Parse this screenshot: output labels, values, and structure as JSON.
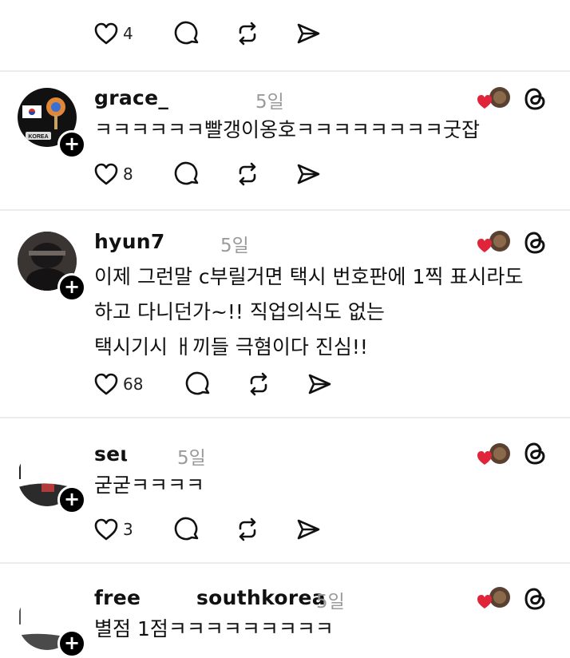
{
  "top_actions": {
    "likes": "4"
  },
  "comments": [
    {
      "username": "grace_",
      "time": "5일",
      "lines": [
        "ㅋㅋㅋㅋㅋㅋ빨갱이옹호ㅋㅋㅋㅋㅋㅋㅋㅋ굿잡"
      ],
      "likes": "8",
      "avatar_label": "KOREA"
    },
    {
      "username": "hyun7",
      "time": "5일",
      "lines": [
        "이제 그런말 c부릴거면 택시 번호판에 1찍 표시라도",
        "하고 다니던가~!! 직업의식도 없는",
        "택시기시 ㅐ끼들 극혐이다 진심!!"
      ],
      "likes": "68"
    },
    {
      "username": "seι",
      "time": "5일",
      "lines": [
        "굳굳ㅋㅋㅋㅋ"
      ],
      "likes": "3"
    },
    {
      "username_left": "free",
      "username_right": "southkorea",
      "time": "5일",
      "lines": [
        "별점 1점ㅋㅋㅋㅋㅋㅋㅋㅋㅋ"
      ]
    }
  ],
  "icons": [
    "heart-icon",
    "comment-icon",
    "repost-icon",
    "share-icon",
    "threads-icon",
    "plus-icon"
  ],
  "colors": {
    "heart_red": "#e0243a",
    "text": "#111111",
    "muted": "#9a9a9a",
    "divider": "#ececec"
  }
}
